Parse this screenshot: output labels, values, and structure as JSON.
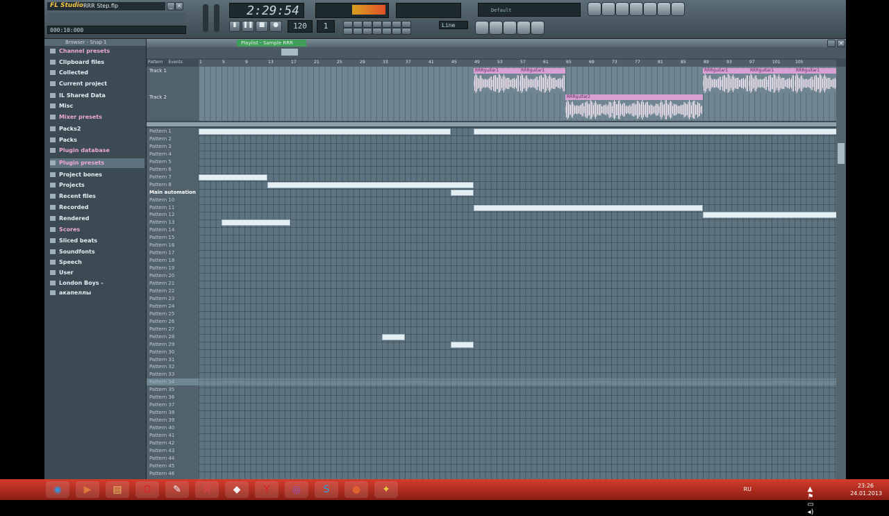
{
  "app": {
    "title": "FL Studio",
    "project_file": "RRR Step.flp",
    "hint": "000:10:000",
    "time": "2:29:54",
    "tempo": "120",
    "pattern_select": "1",
    "snap": "Line",
    "plugin_preset": "Default"
  },
  "browser": {
    "title": "Browser - Snap 1",
    "items": [
      {
        "label": "Channel presets",
        "style": "pink"
      },
      {
        "label": "Clipboard files",
        "style": "normal"
      },
      {
        "label": "Collected",
        "style": "normal"
      },
      {
        "label": "Current project",
        "style": "normal"
      },
      {
        "label": "IL Shared Data",
        "style": "normal"
      },
      {
        "label": "Misc",
        "style": "normal"
      },
      {
        "label": "Mixer presets",
        "style": "pink"
      },
      {
        "label": "Packs2",
        "style": "normal"
      },
      {
        "label": "Packs",
        "style": "normal"
      },
      {
        "label": "Plugin database",
        "style": "pink"
      },
      {
        "label": "Plugin presets",
        "style": "pink-hl"
      },
      {
        "label": "Project bones",
        "style": "normal"
      },
      {
        "label": "Projects",
        "style": "normal"
      },
      {
        "label": "Recent files",
        "style": "normal"
      },
      {
        "label": "Recorded",
        "style": "normal"
      },
      {
        "label": "Rendered",
        "style": "normal"
      },
      {
        "label": "Scores",
        "style": "pink"
      },
      {
        "label": "Sliced beats",
        "style": "normal"
      },
      {
        "label": "Soundfonts",
        "style": "normal"
      },
      {
        "label": "Speech",
        "style": "normal"
      },
      {
        "label": "User",
        "style": "normal"
      },
      {
        "label": "London Boys -",
        "style": "normal"
      },
      {
        "label": "акапеллы",
        "style": "normal"
      }
    ]
  },
  "playlist": {
    "title": "Playlist - Sample RRR",
    "mode_left": "Pattern",
    "mode_right": "Events",
    "ruler": [
      "1",
      "5",
      "9",
      "13",
      "17",
      "21",
      "25",
      "29",
      "33",
      "37",
      "41",
      "45",
      "49",
      "53",
      "57",
      "61",
      "65",
      "69",
      "73",
      "77",
      "81",
      "85",
      "89",
      "93",
      "97",
      "101",
      "105"
    ],
    "tracks": [
      {
        "name": "Track 1"
      },
      {
        "name": "Track 2"
      }
    ],
    "audio_clips": [
      {
        "track": 0,
        "start": 49,
        "length": 8,
        "label": "RRRguitar1"
      },
      {
        "track": 0,
        "start": 57,
        "length": 8,
        "label": "RRRguitar1"
      },
      {
        "track": 1,
        "start": 65,
        "length": 24,
        "label": "RRRguitar2"
      },
      {
        "track": 0,
        "start": 89,
        "length": 8,
        "label": "RRRguitar1"
      },
      {
        "track": 0,
        "start": 97,
        "length": 8,
        "label": "RRRguitar1"
      },
      {
        "track": 0,
        "start": 105,
        "length": 8,
        "label": "RRRguitar1"
      }
    ],
    "patterns": [
      "Pattern 1",
      "Pattern 2",
      "Pattern 3",
      "Pattern 4",
      "Pattern 5",
      "Pattern 6",
      "Pattern 7",
      "Pattern 8",
      "Main automation",
      "Pattern 10",
      "Pattern 11",
      "Pattern 12",
      "Pattern 13",
      "Pattern 14",
      "Pattern 15",
      "Pattern 16",
      "Pattern 17",
      "Pattern 18",
      "Pattern 19",
      "Pattern 20",
      "Pattern 21",
      "Pattern 22",
      "Pattern 23",
      "Pattern 24",
      "Pattern 25",
      "Pattern 26",
      "Pattern 27",
      "Pattern 28",
      "Pattern 29",
      "Pattern 30",
      "Pattern 31",
      "Pattern 32",
      "Pattern 33",
      "Pattern 34",
      "Pattern 35",
      "Pattern 36",
      "Pattern 37",
      "Pattern 38",
      "Pattern 39",
      "Pattern 40",
      "Pattern 41",
      "Pattern 42",
      "Pattern 43",
      "Pattern 44",
      "Pattern 45",
      "Pattern 46"
    ],
    "pattern_blocks": [
      {
        "row": 0,
        "start": 1,
        "length": 44
      },
      {
        "row": 0,
        "start": 49,
        "length": 64
      },
      {
        "row": 6,
        "start": 1,
        "length": 12
      },
      {
        "row": 7,
        "start": 13,
        "length": 36
      },
      {
        "row": 8,
        "start": 45,
        "length": 4
      },
      {
        "row": 10,
        "start": 49,
        "length": 40
      },
      {
        "row": 11,
        "start": 89,
        "length": 24
      },
      {
        "row": 12,
        "start": 5,
        "length": 12
      },
      {
        "row": 27,
        "start": 33,
        "length": 4
      },
      {
        "row": 28,
        "start": 45,
        "length": 4
      }
    ]
  },
  "taskbar": {
    "apps": [
      "Start",
      "Media",
      "Files",
      "Opera",
      "Skype",
      "Yandex",
      "Wolf",
      "Y",
      "Browser",
      "Skype2",
      "Orange",
      "FL"
    ],
    "lang": "RU",
    "clock_time": "23:26",
    "clock_date": "24.01.2013"
  }
}
